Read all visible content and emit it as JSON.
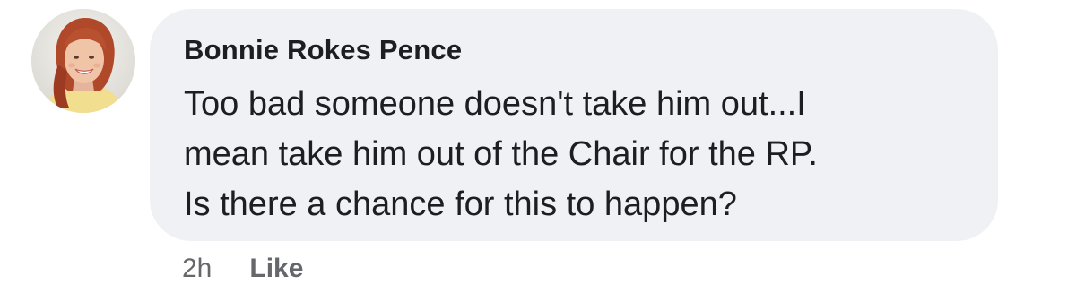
{
  "comment": {
    "author": "Bonnie Rokes Pence",
    "text_lines": [
      "Too bad someone doesn't take him out...I",
      "mean take him out of the Chair for the RP.",
      "Is there a chance for this to happen?"
    ],
    "timestamp": "2h",
    "like_label": "Like",
    "avatar_icon": "profile-photo"
  },
  "colors": {
    "bubble": "#eff1f4",
    "text": "#1c1e21",
    "secondary": "#65676b"
  }
}
